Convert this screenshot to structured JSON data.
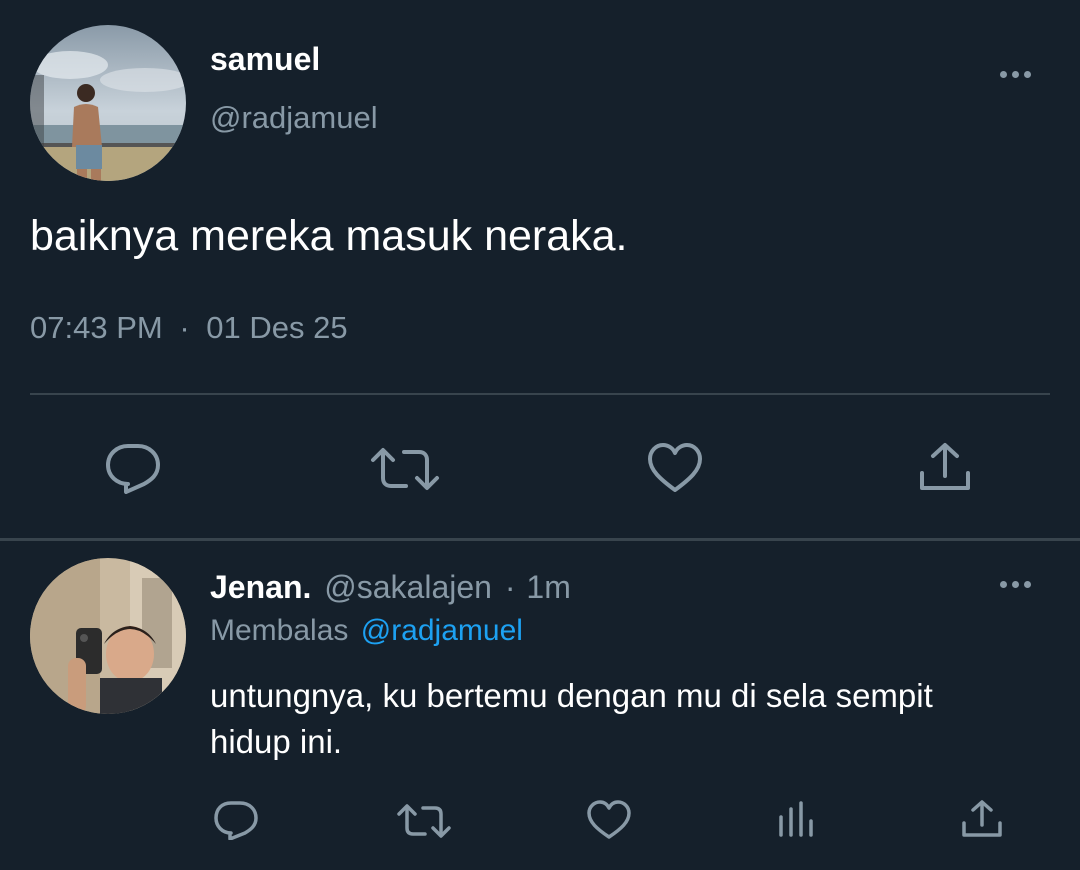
{
  "main_tweet": {
    "display_name": "samuel",
    "handle": "@radjamuel",
    "text": "baiknya mereka masuk neraka.",
    "time": "07:43 PM",
    "separator": "·",
    "date": "01 Des 25"
  },
  "reply": {
    "display_name": "Jenan.",
    "handle": "@sakalajen",
    "separator": "·",
    "age": "1m",
    "replying_label": "Membalas",
    "replying_to": "@radjamuel",
    "text_line1": "untungnya, ku bertemu dengan mu di sela sempit",
    "text_line2": "hidup ini."
  },
  "colors": {
    "background": "#15202b",
    "divider": "#38444d",
    "muted_text": "#8899a6",
    "accent": "#1da1f2",
    "primary_text": "#ffffff"
  },
  "icons": {
    "main_actions": [
      "reply-icon",
      "retweet-icon",
      "like-icon",
      "share-icon"
    ],
    "reply_actions": [
      "reply-icon",
      "retweet-icon",
      "like-icon",
      "analytics-icon",
      "share-icon"
    ],
    "more": "more-options-icon"
  }
}
